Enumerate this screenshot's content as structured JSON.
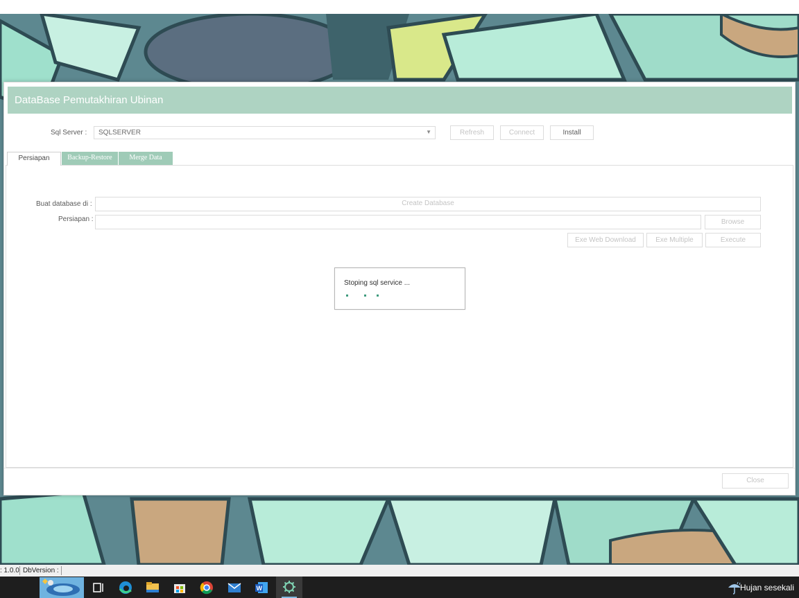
{
  "window": {
    "title": "DataBase Pemutakhiran Ubinan",
    "sql_server_label": "Sql Server :",
    "sql_server_value": "SQLSERVER",
    "refresh_label": "Refresh",
    "connect_label": "Connect",
    "install_label": "Install",
    "tabs": [
      {
        "label": "Persiapan"
      },
      {
        "label": "Backup-Restore"
      },
      {
        "label": "Merge Data"
      }
    ],
    "buat_database_label": "Buat database di  :",
    "create_database_label": "Create Database",
    "persiapan_label": "Persiapan :",
    "browse_label": "Browse",
    "exe_web_download_label": "Exe Web Download",
    "exe_multiple_label": "Exe Multiple",
    "execute_label": "Execute",
    "close_label": "Close"
  },
  "progress_dialog": {
    "message": "Stoping sql service ..."
  },
  "statusbar": {
    "version": ": 1.0.0",
    "db_version": "DbVersion :"
  },
  "taskbar": {
    "weather": "Hujan sesekali"
  },
  "colors": {
    "titlebar": "#aed3c2",
    "tab_inactive": "#9fcbb7",
    "progress_dots": "#3f9b7e",
    "taskbar": "#1e1e1e"
  }
}
